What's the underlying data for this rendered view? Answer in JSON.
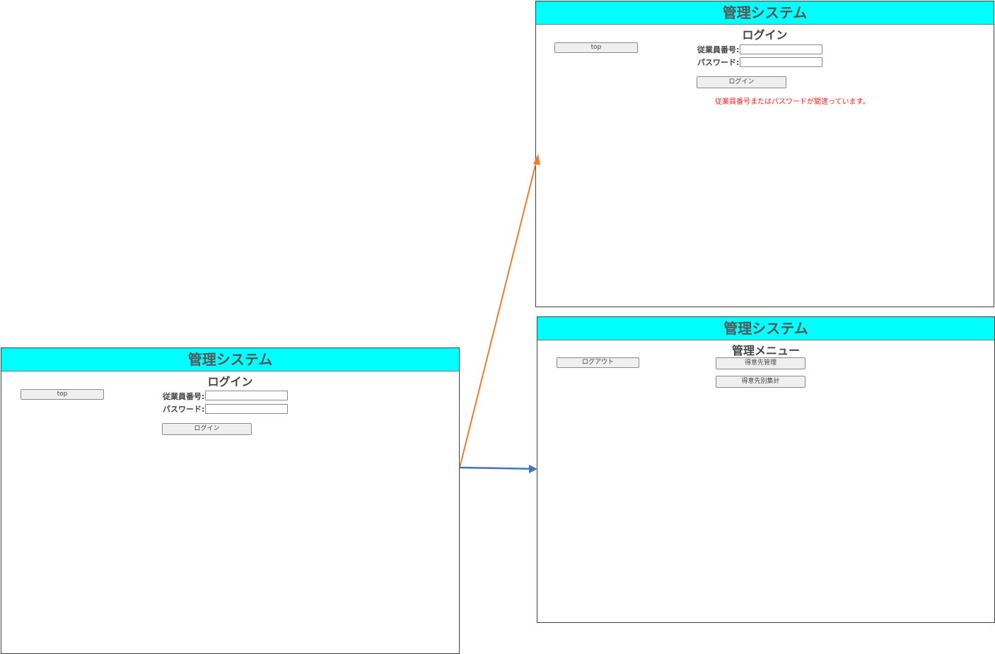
{
  "screens": {
    "login": {
      "title": "管理システム",
      "heading": "ログイン",
      "top_button": "top",
      "employee_label": "従業員番号:",
      "password_label": "パスワード:",
      "employee_value": "",
      "password_value": "",
      "login_button": "ログイン"
    },
    "login_error": {
      "title": "管理システム",
      "heading": "ログイン",
      "top_button": "top",
      "employee_label": "従業員番号:",
      "password_label": "パスワード:",
      "employee_value": "",
      "password_value": "",
      "login_button": "ログイン",
      "error_message": "従業員番号またはパスワードが間違っています。"
    },
    "menu": {
      "title": "管理システム",
      "heading": "管理メニュー",
      "logout_button": "ログアウト",
      "customer_manage_button": "得意先管理",
      "customer_summary_button": "得意先別集計"
    }
  },
  "colors": {
    "title_bar": "#00ffff",
    "arrow_failure": "#ed7d31",
    "arrow_success": "#4472c4",
    "error_text": "#ff2020"
  }
}
